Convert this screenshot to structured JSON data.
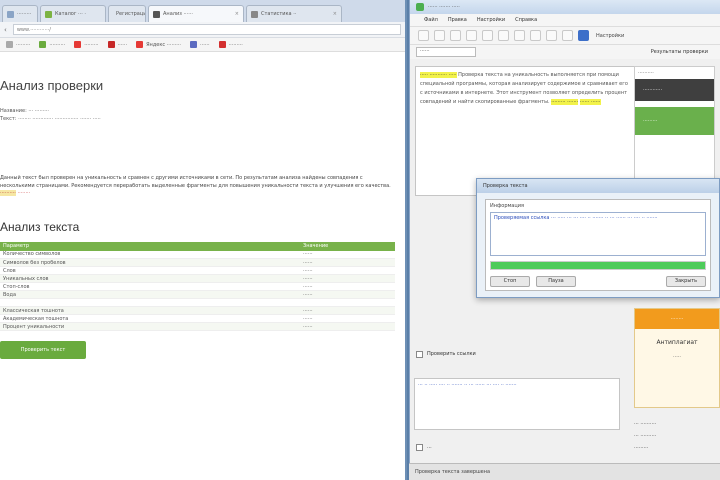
{
  "browser": {
    "tabs": [
      {
        "label": "·········"
      },
      {
        "label": "Каталог ··· ·"
      },
      {
        "label": "Регистрация ··· ×"
      },
      {
        "label": "Анализ ······"
      },
      {
        "label": "Статистика ··"
      }
    ],
    "url": "www.············/",
    "bookmarks": [
      "·········",
      "··········",
      "·········",
      "······",
      "Яндекс ·········",
      "······",
      "·········"
    ],
    "page_title": "Анализ проверки",
    "meta_line1": "Название: ··· ·········",
    "meta_line2": "Текст: ········ ············· ··············· ······· ·····",
    "paragraph": "Данный текст был проверен на уникальность и сравнен с другими источниками в сети. По результатам анализа найдены совпадения с несколькими страницами. Рекомендуется переработать выделенные фрагменты для повышения уникальности текста и улучшения его качества.",
    "paragraph_highlight": "··········",
    "paragraph_red": "········",
    "section_title": "Анализ текста",
    "table_headers": [
      "Параметр",
      "Значение"
    ],
    "table_rows": [
      [
        "Количество символов",
        "······"
      ],
      [
        "Символов без пробелов",
        "······"
      ],
      [
        "Слов",
        "······"
      ],
      [
        "Уникальных слов",
        "······"
      ],
      [
        "Стоп-слов",
        "······"
      ],
      [
        "Вода",
        "······"
      ],
      [
        "",
        ""
      ],
      [
        "Классическая тошнота",
        "······"
      ],
      [
        "Академическая тошнота",
        "······"
      ],
      [
        "Процент уникальности",
        "······"
      ]
    ],
    "check_button": "Проверить текст"
  },
  "app": {
    "title": "······ ······· ·····",
    "menu": [
      "Файл",
      "Правка",
      "Настройки",
      "Справка"
    ],
    "toolbar_label": "Настройки",
    "select_value": "······",
    "tab_label": "Результаты проверки",
    "editor_text": "Проверка текста на уникальность выполняется при помощи специальной программы, которая анализирует содержимое и сравнивает его с источниками в интернете. Этот инструмент позволяет определить процент совпадений и найти скопированные фрагменты.",
    "editor_highlights": [
      "····· ··········· ·····",
      "········· ·······",
      "······ ······"
    ],
    "panel_head": "··········",
    "panel_dark": "············",
    "panel_green": "·········",
    "dialog": {
      "title": "Проверка текста",
      "label": "Информация",
      "text": "Проверяемая ссылка ··· ····· ··· ··· ···· ·· ······· ·· ··· ······ ··· ···· ·· ·······",
      "progress": 1.0,
      "buttons": [
        "Стоп",
        "Пауза",
        "Закрыть"
      ]
    },
    "orange": {
      "head": "········",
      "title": "Антиплагиат",
      "date": "·····"
    },
    "checkbox_label": "Проверить ссылки",
    "log_text": "··· ·· ····· ···· ·· ······· ·· ··· ······ ··· ···· ·· ·······",
    "lower_label": "···",
    "side_items": [
      "··· ··········",
      "··· ··········",
      "·········"
    ],
    "status_text": "Проверка текста завершена"
  }
}
